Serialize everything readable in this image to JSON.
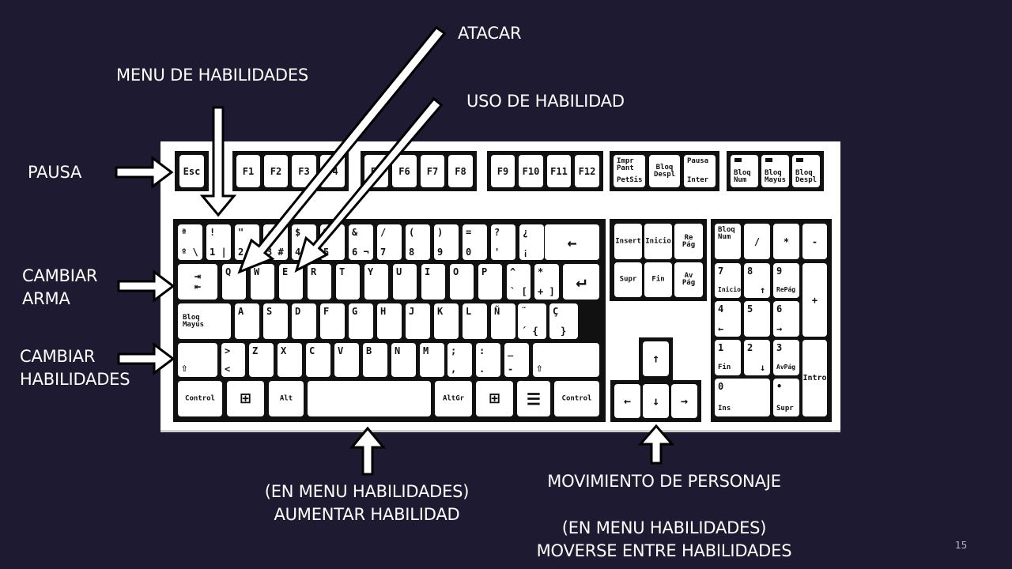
{
  "labels": {
    "atacar": "ATACAR",
    "menu_habilidades": "MENU DE HABILIDADES",
    "uso_habilidad": "USO DE HABILIDAD",
    "pausa": "PAUSA",
    "cambiar_arma_1": "CAMBIAR",
    "cambiar_arma_2": "ARMA",
    "cambiar_habilidades_1": "CAMBIAR",
    "cambiar_habilidades_2": "HABILIDADES",
    "aumentar_1": "(EN MENU HABILIDADES)",
    "aumentar_2": "AUMENTAR HABILIDAD",
    "movimiento": "MOVIMIENTO DE PERSONAJE",
    "moverse_1": "(EN MENU HABILIDADES)",
    "moverse_2": "MOVERSE ENTRE HABILIDADES"
  },
  "page_number": "15",
  "keys": {
    "esc": "Esc",
    "f1": "F1",
    "f2": "F2",
    "f3": "F3",
    "f4": "F4",
    "f5": "F5",
    "f6": "F6",
    "f7": "F7",
    "f8": "F8",
    "f9": "F9",
    "f10": "F10",
    "f11": "F11",
    "f12": "F12",
    "impr_top": "Impr\nPant",
    "impr_bottom": "PetSis",
    "bloq_despl": "Bloq\nDespl",
    "pausa_top": "Pausa",
    "pausa_bottom": "Inter",
    "bloq_num": "Bloq\nNum",
    "bloq_mayus_led": "Bloq\nMayús",
    "bloq_despl_led": "Bloq\nDespl",
    "n_top": [
      "ª",
      "!",
      "\"",
      "·",
      "$",
      "%",
      "&",
      "/",
      "(",
      ")",
      "=",
      "?",
      "¿"
    ],
    "n_bottom": [
      "º \\",
      "1 |",
      "2 @",
      "3 #",
      "4 ~",
      "5",
      "6 ¬",
      "7",
      "8",
      "9",
      "0",
      "'",
      "¡"
    ],
    "backspace": "←",
    "tab": "⇥\n⇤",
    "row_q": [
      "Q",
      "W",
      "E",
      "R",
      "T",
      "Y",
      "U",
      "I",
      "O",
      "P"
    ],
    "grave_top": "^",
    "grave_bottom": "` [",
    "plus_top": "*",
    "plus_bottom": "+ ]",
    "enter": "↵",
    "caps": "Bloq\nMayús",
    "row_a": [
      "A",
      "S",
      "D",
      "F",
      "G",
      "H",
      "J",
      "K",
      "L",
      "Ñ"
    ],
    "acute_top": "¨",
    "acute_bottom": "´ {",
    "cedil_top": "Ç",
    "cedil_bottom": "}",
    "shift": "⇧",
    "lt_top": ">",
    "lt_bottom": "<",
    "row_z": [
      "Z",
      "X",
      "C",
      "V",
      "B",
      "N",
      "M"
    ],
    "comma_top": ";",
    "comma_bottom": ",",
    "period_top": ":",
    "period_bottom": ".",
    "minus_top": "_",
    "minus_bottom": "-",
    "control": "Control",
    "win_glyph": "⊞",
    "alt": "Alt",
    "altgr": "AltGr",
    "menu_glyph": "☰",
    "insert": "Insert",
    "inicio": "Inicio",
    "repag": "Re\nPág",
    "supr": "Supr",
    "fin": "Fin",
    "avpag": "Av\nPág",
    "up": "↑",
    "left": "←",
    "down": "↓",
    "right": "→",
    "np_bloq": "Bloq\nNum",
    "np_div": "/",
    "np_mul": "*",
    "np_sub": "-",
    "np7": "7",
    "np7b": "Inicio",
    "np8": "8",
    "np8b": "↑",
    "np9": "9",
    "np9b": "RePág",
    "np_add": "+",
    "np4": "4",
    "np4b": "←",
    "np5": "5",
    "np6": "6",
    "np6b": "→",
    "np1": "1",
    "np1b": "Fin",
    "np2": "2",
    "np2b": "↓",
    "np3": "3",
    "np3b": "AvPág",
    "np_enter": "Intro",
    "np0": "0",
    "np0b": "Ins",
    "npdot": "•",
    "npdotb": "Supr"
  }
}
